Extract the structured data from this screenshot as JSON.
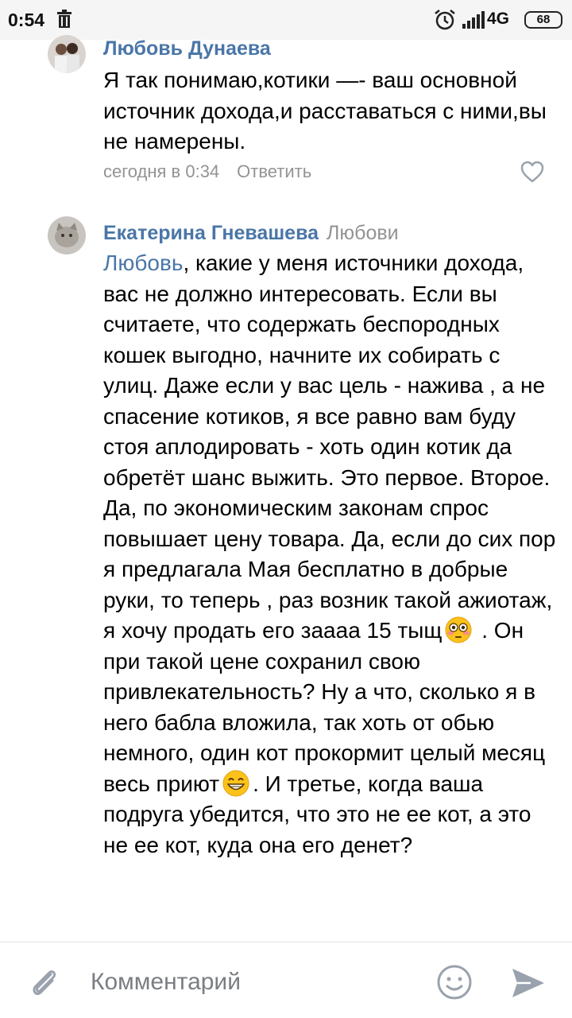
{
  "status_bar": {
    "time": "0:54",
    "network": "4G",
    "battery": "68"
  },
  "comments": [
    {
      "author": "Любовь Дунаева",
      "text": "Я так понимаю,котики —- ваш основной источник дохода,и расставаться с ними,вы не намерены.",
      "time": "сегодня в 0:34",
      "reply_label": "Ответить"
    },
    {
      "author": "Екатерина Гневашева",
      "reply_to": "Любови",
      "mention": "Любовь",
      "text_part1": ", какие у меня источники дохода, вас не должно интересовать. Если вы считаете, что содержать беспородных кошек выгодно, начните их собирать с улиц. Даже если у вас цель - нажива , а не спасение котиков, я все равно вам буду стоя аплодировать - хоть один котик да обретёт шанс выжить. Это первое. Второе. Да, по экономическим законам спрос повышает цену товара. Да, если до сих пор я предлагала Мая бесплатно в добрые руки, то теперь , раз возник такой ажиотаж, я хочу продать его заааа 15 тыщ",
      "text_part2": " . Он при такой цене сохранил свою привлекательность? Ну а что, сколько я в него бабла вложила, так хоть от обью немного, один кот прокормит целый месяц весь приют",
      "text_part3": ". И третье, когда ваша подруга убедится, что это не ее кот, а это не ее кот, куда она его денет?"
    }
  ],
  "composer": {
    "placeholder": "Комментарий"
  },
  "icons": {
    "attach": "paperclip-icon",
    "smile": "smile-icon",
    "send": "send-icon",
    "like": "heart-icon"
  },
  "colors": {
    "link": "#4a76a8",
    "meta": "#939393"
  }
}
